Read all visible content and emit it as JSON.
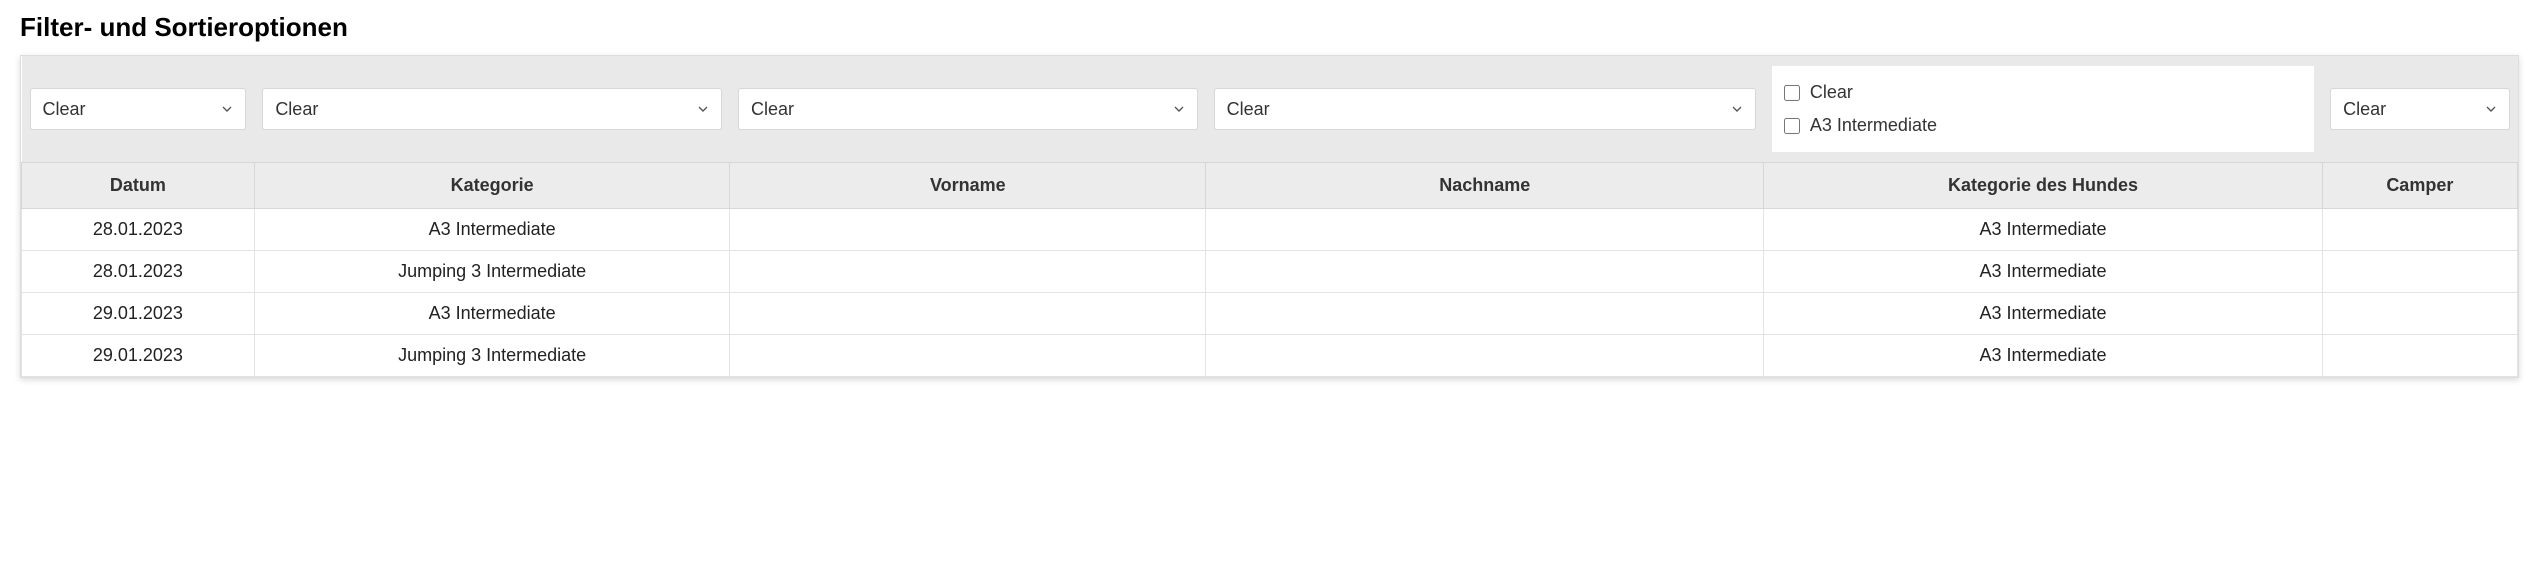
{
  "page": {
    "title": "Filter- und Sortieroptionen"
  },
  "filters": {
    "datum": {
      "selected": "Clear"
    },
    "kategorie": {
      "selected": "Clear"
    },
    "vorname": {
      "selected": "Clear"
    },
    "nachname": {
      "selected": "Clear"
    },
    "hundkat": {
      "options": [
        {
          "label": "Clear",
          "checked": false
        },
        {
          "label": "A3 Intermediate",
          "checked": false
        }
      ]
    },
    "camper": {
      "selected": "Clear"
    }
  },
  "columns": {
    "datum": "Datum",
    "kategorie": "Kategorie",
    "vorname": "Vorname",
    "nachname": "Nachname",
    "hundkat": "Kategorie des Hundes",
    "camper": "Camper"
  },
  "rows": [
    {
      "datum": "28.01.2023",
      "kategorie": "A3 Intermediate",
      "vorname": "",
      "nachname": "",
      "hundkat": "A3 Intermediate",
      "camper": ""
    },
    {
      "datum": "28.01.2023",
      "kategorie": "Jumping 3 Intermediate",
      "vorname": "",
      "nachname": "",
      "hundkat": "A3 Intermediate",
      "camper": ""
    },
    {
      "datum": "29.01.2023",
      "kategorie": "A3 Intermediate",
      "vorname": "",
      "nachname": "",
      "hundkat": "A3 Intermediate",
      "camper": ""
    },
    {
      "datum": "29.01.2023",
      "kategorie": "Jumping 3 Intermediate",
      "vorname": "",
      "nachname": "",
      "hundkat": "A3 Intermediate",
      "camper": ""
    }
  ]
}
